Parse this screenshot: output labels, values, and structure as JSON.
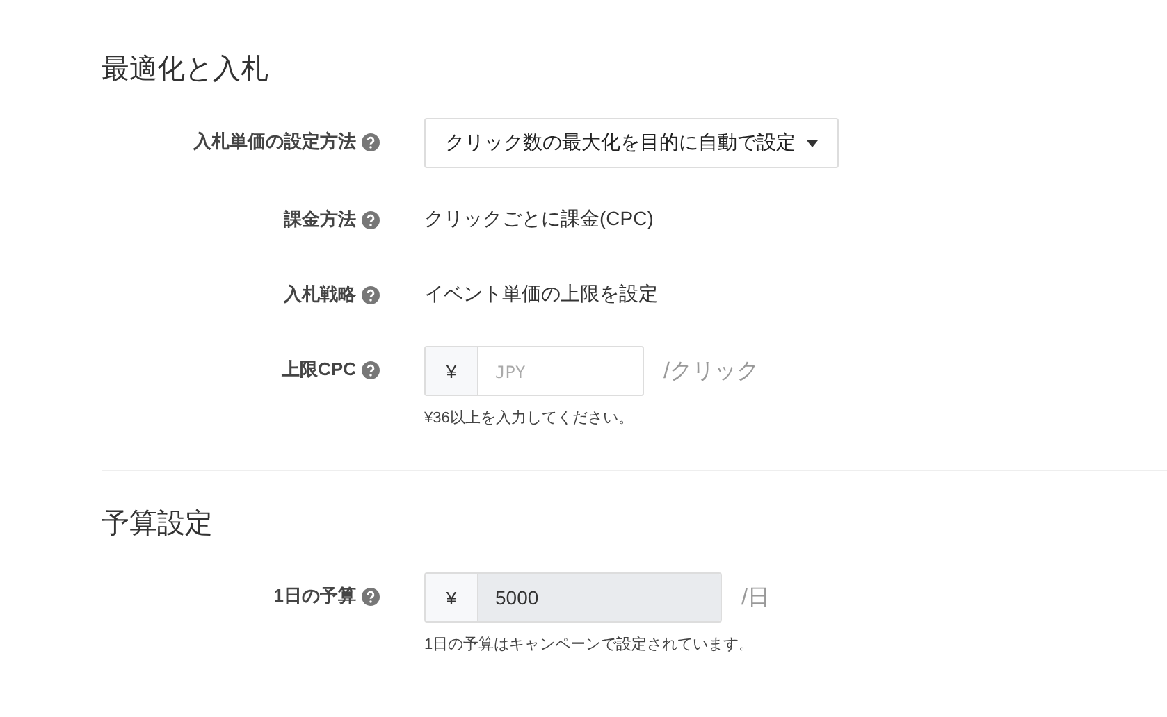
{
  "sections": [
    {
      "title": "最適化と入札",
      "rows": [
        {
          "kind": "dropdown",
          "label": "入札単価の設定方法",
          "help_icon": true,
          "value": "クリック数の最大化を目的に自動で設定"
        },
        {
          "kind": "text",
          "label": "課金方法",
          "help_icon": true,
          "value": "クリックごとに課金(CPC)"
        },
        {
          "kind": "text",
          "label": "入札戦略",
          "help_icon": true,
          "value": "イベント単価の上限を設定"
        },
        {
          "kind": "currency",
          "label": "上限CPC",
          "help_icon": true,
          "prefix": "¥",
          "placeholder": "JPY",
          "disabled": false,
          "unit": "/クリック",
          "hint": "¥36以上を入力してください。"
        }
      ]
    },
    {
      "title": "予算設定",
      "rows": [
        {
          "kind": "currency",
          "label": "1日の予算",
          "help_icon": true,
          "prefix": "¥",
          "value": "5000",
          "disabled": true,
          "unit": "/日",
          "hint": "1日の予算はキャンペーンで設定されています。"
        }
      ]
    }
  ]
}
